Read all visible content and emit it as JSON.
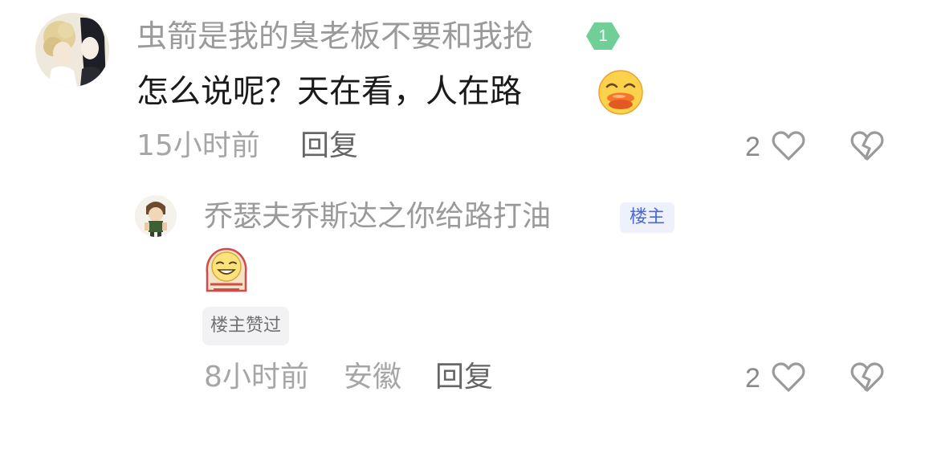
{
  "main_comment": {
    "username": "虫箭是我的臭老板不要和我抢",
    "level": "1",
    "text": "怎么说呢？天在看，人在路",
    "emoji": "grinning-duck-lips-emoji",
    "time": "15小时前",
    "reply_label": "回复",
    "like_count": "2"
  },
  "reply": {
    "username": "乔瑟夫乔斯达之你给路打油",
    "op_badge": "楼主",
    "sticker": "grinning-face-sticker",
    "op_liked": "楼主赞过",
    "time": "8小时前",
    "location": "安徽",
    "reply_label": "回复",
    "like_count": "2"
  },
  "colors": {
    "username": "#9a9a9a",
    "level_badge": "#6fcf97",
    "op_badge_text": "#4a69d6",
    "op_badge_bg": "#eef1fb"
  },
  "icons": [
    "heart-outline-icon",
    "broken-heart-icon"
  ]
}
